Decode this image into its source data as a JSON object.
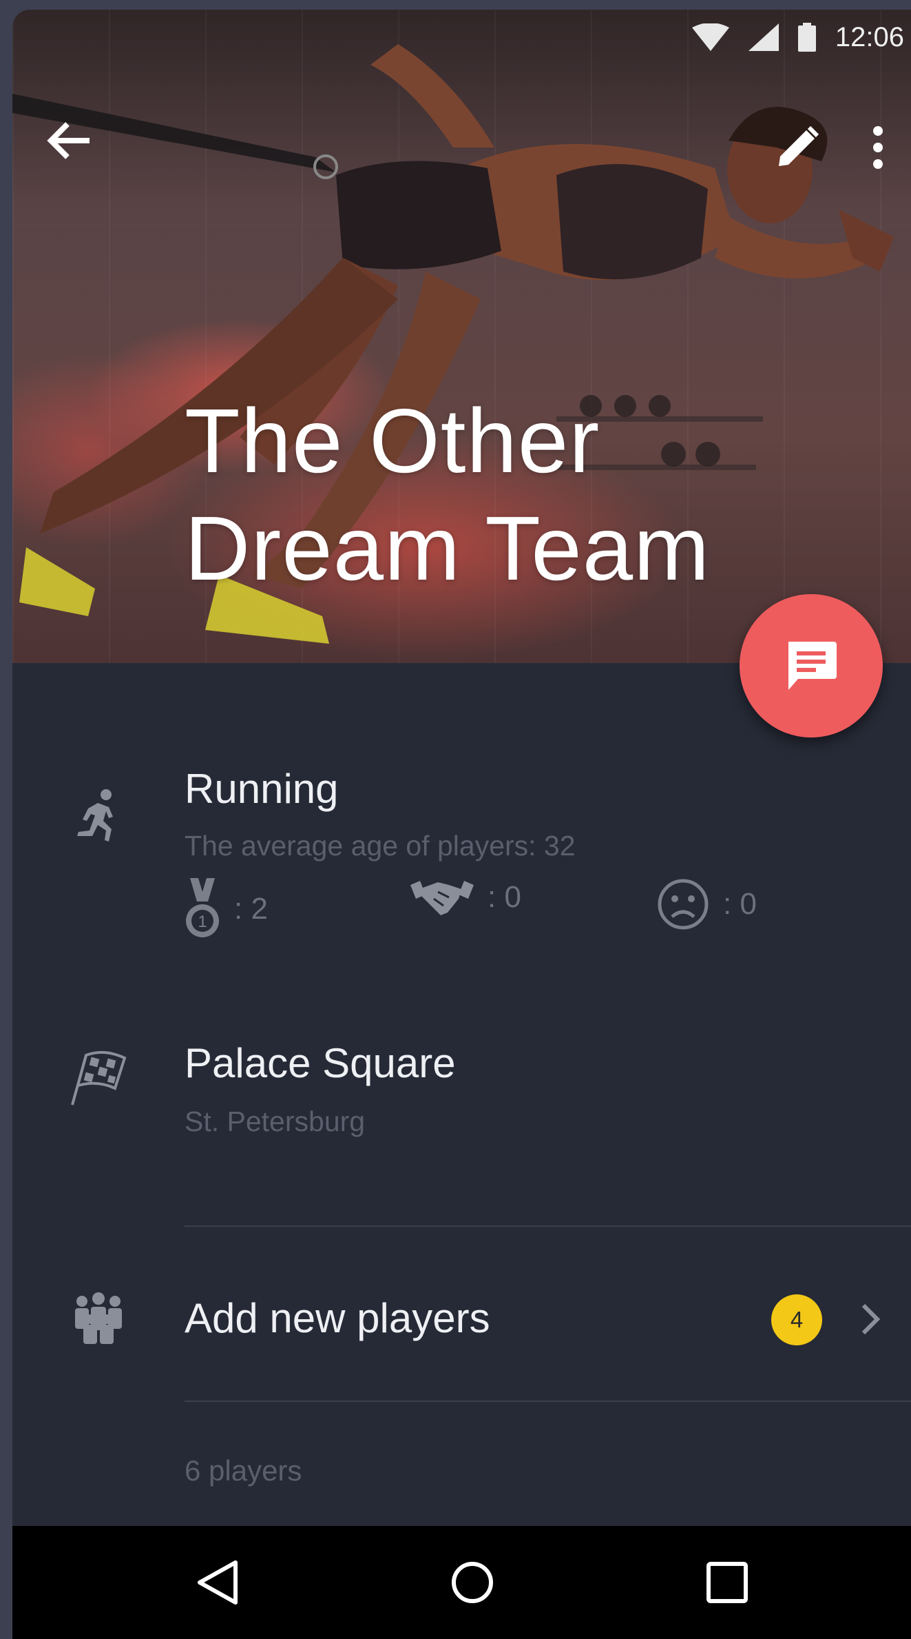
{
  "status_bar": {
    "time": "12:06"
  },
  "app_bar": {
    "back_icon": "arrow-back-icon",
    "edit_icon": "pencil-icon",
    "more_icon": "more-vert-icon"
  },
  "team": {
    "title_line1": "The Other",
    "title_line2": "Dream Team"
  },
  "fab": {
    "icon": "chat-icon",
    "color": "#ef5c5e"
  },
  "sport": {
    "name": "Running",
    "subtitle": "The average age of players: 32",
    "stats": {
      "wins": ": 2",
      "draws": ": 0",
      "losses": ": 0"
    }
  },
  "location": {
    "place": "Palace Square",
    "city": "St. Petersburg"
  },
  "players": {
    "add_label": "Add new players",
    "badge": "4",
    "count_label": "6 players"
  },
  "colors": {
    "background": "#262a36",
    "accent": "#ef5c5e",
    "badge": "#f3c816"
  }
}
